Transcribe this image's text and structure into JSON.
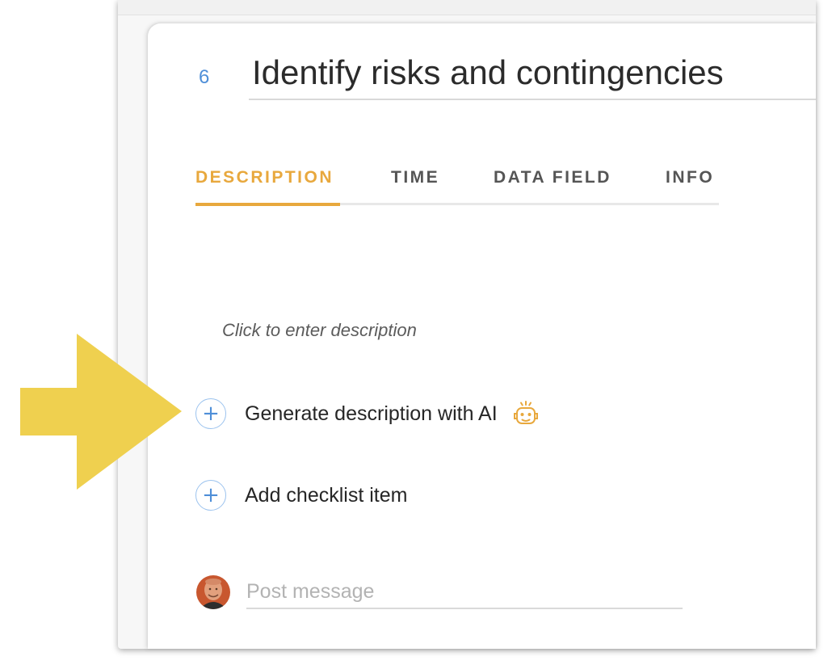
{
  "task": {
    "number": "6",
    "title": "Identify risks and contingencies"
  },
  "tabs": [
    {
      "label": "DESCRIPTION",
      "active": true
    },
    {
      "label": "TIME",
      "active": false
    },
    {
      "label": "DATA FIELD",
      "active": false
    },
    {
      "label": "INFO",
      "active": false
    }
  ],
  "description": {
    "placeholder": "Click to enter description"
  },
  "actions": {
    "generate_ai": {
      "icon": "plus-circle-icon",
      "label": "Generate description with AI",
      "badge_icon": "robot-icon"
    },
    "add_checklist": {
      "icon": "plus-circle-icon",
      "label": "Add checklist item"
    }
  },
  "comment": {
    "placeholder": "Post message",
    "avatar_icon": "user-avatar"
  },
  "colors": {
    "accent_orange": "#e8a83d",
    "accent_blue": "#4f8fd8",
    "arrow_yellow": "#efd04f"
  }
}
